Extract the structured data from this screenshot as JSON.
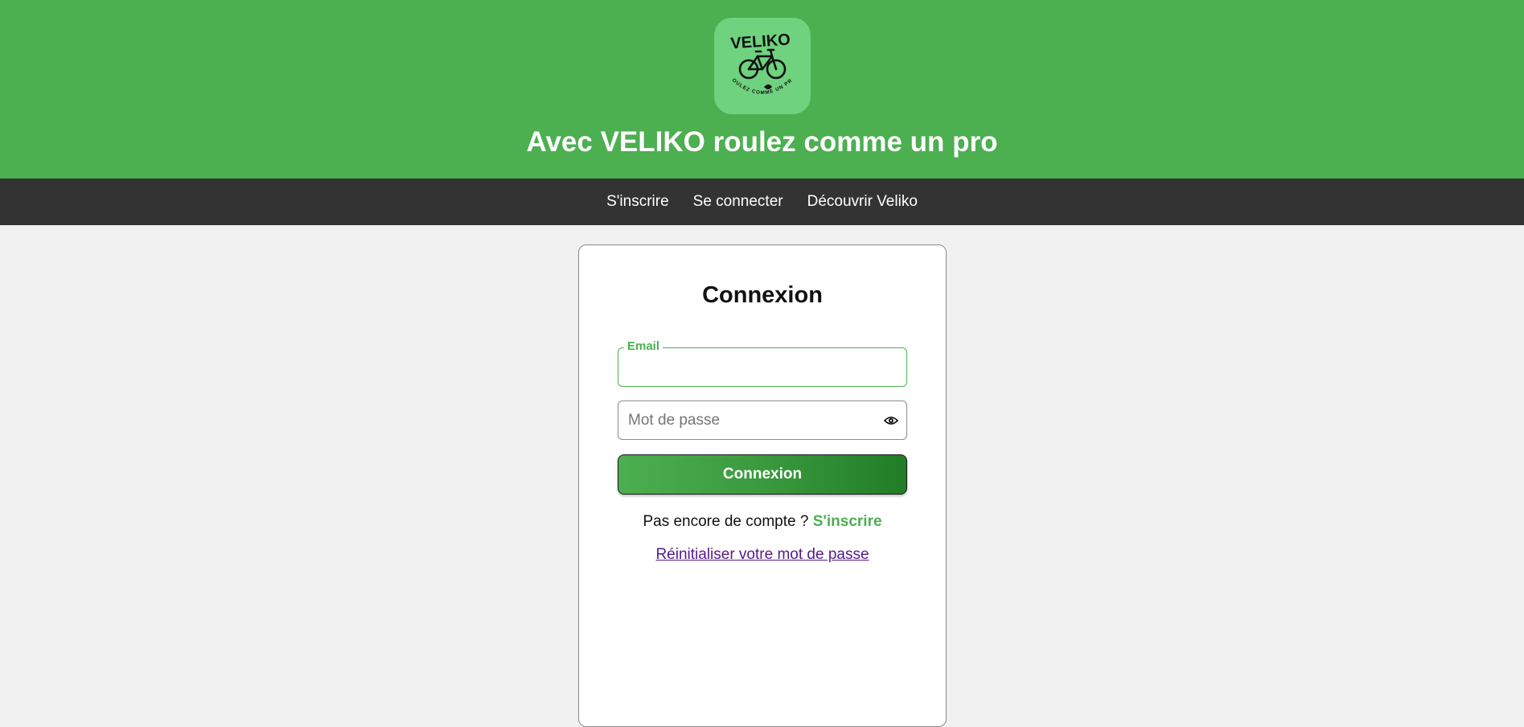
{
  "header": {
    "logo": {
      "icon": "veliko-bicycle-logo",
      "wordmark": "VELIKO",
      "tagline": "ROULEZ COMME UN PRO"
    },
    "title": "Avec VELIKO roulez comme un pro"
  },
  "nav": {
    "items": [
      {
        "label": "S'inscrire"
      },
      {
        "label": "Se connecter"
      },
      {
        "label": "Découvrir Veliko"
      }
    ]
  },
  "login_form": {
    "title": "Connexion",
    "email": {
      "label": "Email",
      "value": ""
    },
    "password": {
      "placeholder": "Mot de passe",
      "value": "",
      "toggle_icon": "eye-icon"
    },
    "submit_label": "Connexion",
    "signup_prompt": "Pas encore de compte ?",
    "signup_link": "S'inscrire",
    "reset_link": "Réinitialiser votre mot de passe"
  },
  "colors": {
    "brand_green": "#4caf50",
    "nav_dark": "#333333",
    "link_visited": "#551a8b",
    "page_bg": "#f1f1f1"
  }
}
